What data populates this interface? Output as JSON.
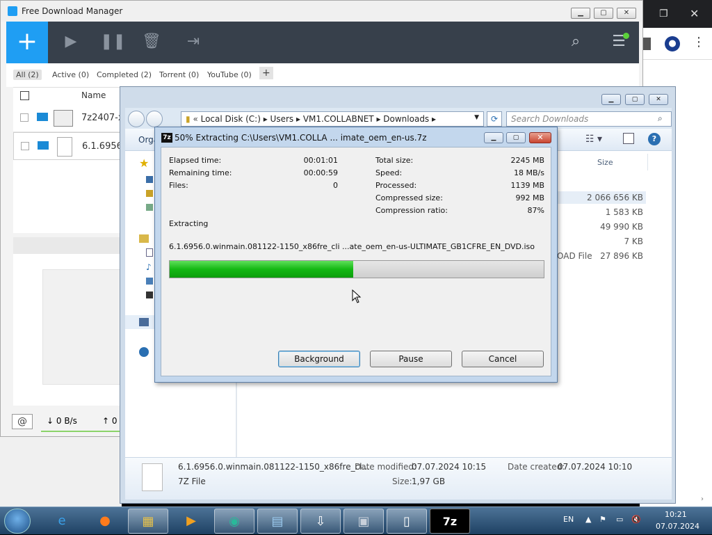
{
  "fdm": {
    "title": "Free Download Manager",
    "filters": [
      {
        "label": "All (2)"
      },
      {
        "label": "Active (0)"
      },
      {
        "label": "Completed (2)"
      },
      {
        "label": "Torrent (0)"
      },
      {
        "label": "YouTube (0)"
      }
    ],
    "add_filter_label": "+",
    "column_name": "Name",
    "rows": [
      {
        "name": "7z2407-x"
      },
      {
        "name": "6.1.6956"
      }
    ],
    "speed_down": "↓ 0 B/s",
    "speed_up": "↑ 0"
  },
  "explorer": {
    "breadcrumb": [
      "Local Disk (C:)",
      "Users",
      "VM1.COLLABNET",
      "Downloads"
    ],
    "search_placeholder": "Search Downloads",
    "organize_label": "Orga",
    "size_header": "Size",
    "sizes": [
      "2 066 656 KB",
      "1 583 KB",
      "49 990 KB",
      "7 KB",
      "27 896 KB"
    ],
    "type_fragment": "OAD File",
    "details": {
      "filename": "6.1.6956.0.winmain.081122-1150_x86fre_cl...",
      "filetype": "7Z File",
      "date_modified_label": "Date modified:",
      "date_modified": "07.07.2024 10:15",
      "date_created_label": "Date created:",
      "date_created": "07.07.2024 10:10",
      "size_label": "Size:",
      "size": "1,97 GB"
    }
  },
  "dialog": {
    "title": "50% Extracting C:\\Users\\VM1.COLLA ... imate_oem_en-us.7z",
    "icon_text": "7z",
    "left_stats": [
      {
        "label": "Elapsed time:",
        "value": "00:01:01"
      },
      {
        "label": "Remaining time:",
        "value": "00:00:59"
      },
      {
        "label": "Files:",
        "value": "0"
      }
    ],
    "right_stats": [
      {
        "label": "Total size:",
        "value": "2245 MB"
      },
      {
        "label": "Speed:",
        "value": "18 MB/s"
      },
      {
        "label": "Processed:",
        "value": "1139 MB"
      },
      {
        "label": "Compressed size:",
        "value": "992 MB"
      },
      {
        "label": "Compression ratio:",
        "value": "87%"
      }
    ],
    "status": "Extracting",
    "current_file": "6.1.6956.0.winmain.081122-1150_x86fre_cli ...ate_oem_en-us-ULTIMATE_GB1CFRE_EN_DVD.iso",
    "progress": 0.49,
    "buttons": {
      "background": "Background",
      "pause": "Pause",
      "cancel": "Cancel"
    }
  },
  "taskbar": {
    "language": "EN",
    "time": "10:21",
    "date": "07.07.2024",
    "apps": [
      "start-orb",
      "internet-explorer",
      "firefox",
      "file-explorer",
      "media-player",
      "app-teal",
      "control-panel",
      "free-download-manager",
      "installer",
      "document",
      "7zip"
    ]
  },
  "colors": {
    "fdm_toolbar": "#37404b",
    "fdm_accent": "#1f9ef3",
    "progress_green": "#14b814"
  }
}
